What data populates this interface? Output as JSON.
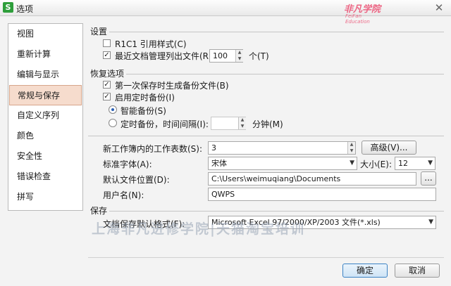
{
  "window": {
    "title": "选项",
    "app_icon": "S",
    "close": "✕"
  },
  "watermark": {
    "logo_big": "非凡学院",
    "logo_small": "FeiFan Education",
    "text": "上海非凡进修学院|天猫淘宝培训"
  },
  "sidebar": {
    "items": [
      {
        "label": "视图"
      },
      {
        "label": "重新计算"
      },
      {
        "label": "编辑与显示"
      },
      {
        "label": "常规与保存",
        "active": true
      },
      {
        "label": "自定义序列"
      },
      {
        "label": "颜色"
      },
      {
        "label": "安全性"
      },
      {
        "label": "错误检查"
      },
      {
        "label": "拼写"
      }
    ]
  },
  "settings": {
    "title": "设置",
    "r1c1": {
      "label": "R1C1 引用样式(C)",
      "checked": false
    },
    "recent": {
      "label": "最近文档管理列出文件(R):",
      "checked": true,
      "value": "100",
      "unit": "个(T)"
    }
  },
  "recovery": {
    "title": "恢复选项",
    "first_save": {
      "label": "第一次保存时生成备份文件(B)",
      "checked": true
    },
    "timed": {
      "label": "启用定时备份(I)",
      "checked": true
    },
    "smart": {
      "label": "智能备份(S)",
      "selected": true
    },
    "interval": {
      "label": "定时备份，时间间隔(I):",
      "selected": false,
      "value": "",
      "unit": "分钟(M)"
    }
  },
  "workbook": {
    "sheets_label": "新工作簿内的工作表数(S):",
    "sheets_value": "3",
    "advanced_button": "高级(V)...",
    "font_label": "标准字体(A):",
    "font_value": "宋体",
    "size_label": "大小(E):",
    "size_value": "12",
    "location_label": "默认文件位置(D):",
    "location_value": "C:\\Users\\weimuqiang\\Documents",
    "browse_button": "...",
    "username_label": "用户名(N):",
    "username_value": "QWPS"
  },
  "save": {
    "title": "保存",
    "format_label": "文档保存默认格式(F):",
    "format_value": "Microsoft Excel 97/2000/XP/2003 文件(*.xls)"
  },
  "buttons": {
    "ok": "确定",
    "cancel": "取消"
  }
}
